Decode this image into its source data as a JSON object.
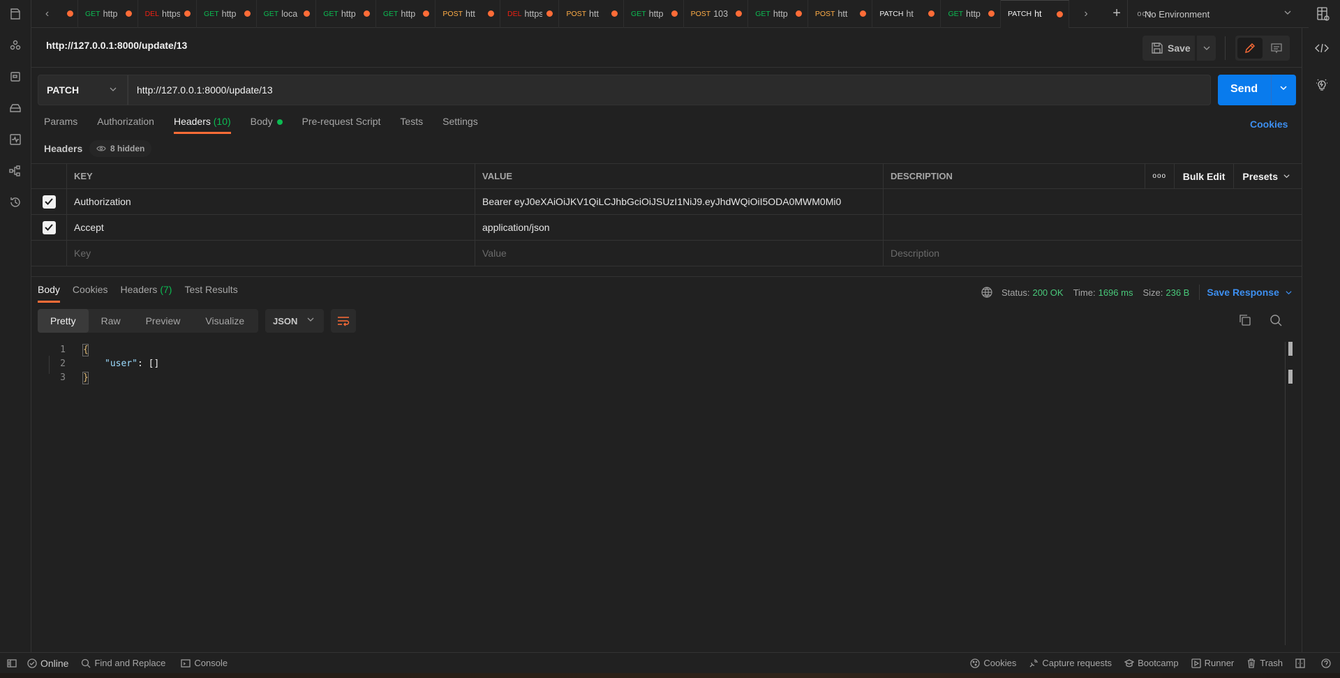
{
  "tabs": [
    {
      "method": "",
      "url": "",
      "method_class": ""
    },
    {
      "method": "GET",
      "url": "http",
      "method_class": "m-get"
    },
    {
      "method": "DEL",
      "url": "https",
      "method_class": "m-del"
    },
    {
      "method": "GET",
      "url": "http",
      "method_class": "m-get"
    },
    {
      "method": "GET",
      "url": "loca",
      "method_class": "m-get"
    },
    {
      "method": "GET",
      "url": "http",
      "method_class": "m-get"
    },
    {
      "method": "GET",
      "url": "http",
      "method_class": "m-get"
    },
    {
      "method": "POST",
      "url": "htt",
      "method_class": "m-post"
    },
    {
      "method": "DEL",
      "url": "https",
      "method_class": "m-del"
    },
    {
      "method": "POST",
      "url": "htt",
      "method_class": "m-post"
    },
    {
      "method": "GET",
      "url": "http",
      "method_class": "m-get"
    },
    {
      "method": "POST",
      "url": "103",
      "method_class": "m-post"
    },
    {
      "method": "GET",
      "url": "http",
      "method_class": "m-get"
    },
    {
      "method": "POST",
      "url": "htt",
      "method_class": "m-post"
    },
    {
      "method": "PATCH",
      "url": "ht",
      "method_class": "m-patch"
    },
    {
      "method": "GET",
      "url": "http",
      "method_class": "m-get"
    },
    {
      "method": "PATCH",
      "url": "ht",
      "method_class": "m-patch",
      "active": true
    }
  ],
  "environment": {
    "selected": "No Environment"
  },
  "request": {
    "title": "http://127.0.0.1:8000/update/13",
    "method": "PATCH",
    "url": "http://127.0.0.1:8000/update/13",
    "save_label": "Save",
    "send_label": "Send"
  },
  "request_tabs": [
    {
      "label": "Params"
    },
    {
      "label": "Authorization"
    },
    {
      "label": "Headers",
      "count": "(10)",
      "active": true
    },
    {
      "label": "Body",
      "dot": true
    },
    {
      "label": "Pre-request Script"
    },
    {
      "label": "Tests"
    },
    {
      "label": "Settings"
    }
  ],
  "cookies_link": "Cookies",
  "headers_section": {
    "title": "Headers",
    "hidden_label": "8 hidden"
  },
  "headers_table": {
    "columns": {
      "key": "KEY",
      "value": "VALUE",
      "description": "DESCRIPTION"
    },
    "actions": {
      "more": "ooo",
      "bulk_edit": "Bulk Edit",
      "presets": "Presets"
    },
    "rows": [
      {
        "checked": true,
        "key": "Authorization",
        "value": "Bearer eyJ0eXAiOiJKV1QiLCJhbGciOiJSUzI1NiJ9.eyJhdWQiOiI5ODA0MWM0Mi0",
        "description": ""
      },
      {
        "checked": true,
        "key": "Accept",
        "value": "application/json",
        "description": ""
      }
    ],
    "placeholders": {
      "key": "Key",
      "value": "Value",
      "description": "Description"
    }
  },
  "response": {
    "tabs": [
      {
        "label": "Body",
        "active": true
      },
      {
        "label": "Cookies"
      },
      {
        "label": "Headers",
        "count": "(7)"
      },
      {
        "label": "Test Results"
      }
    ],
    "status_label": "Status:",
    "status": "200 OK",
    "time_label": "Time:",
    "time": "1696 ms",
    "size_label": "Size:",
    "size": "236 B",
    "save_response": "Save Response",
    "views": [
      "Pretty",
      "Raw",
      "Preview",
      "Visualize"
    ],
    "active_view": "Pretty",
    "format": "JSON",
    "code_lines": [
      {
        "n": "1",
        "text": "{"
      },
      {
        "n": "2",
        "key": "\"user\"",
        "rest": ": []"
      },
      {
        "n": "3",
        "text": "}"
      }
    ]
  },
  "statusbar": {
    "online": "Online",
    "find_replace": "Find and Replace",
    "console": "Console",
    "cookies": "Cookies",
    "capture": "Capture requests",
    "bootcamp": "Bootcamp",
    "runner": "Runner",
    "trash": "Trash"
  },
  "colors": {
    "accent": "#ff6c37",
    "send": "#097bed",
    "link": "#3d8ff0",
    "success": "#49c97a"
  }
}
